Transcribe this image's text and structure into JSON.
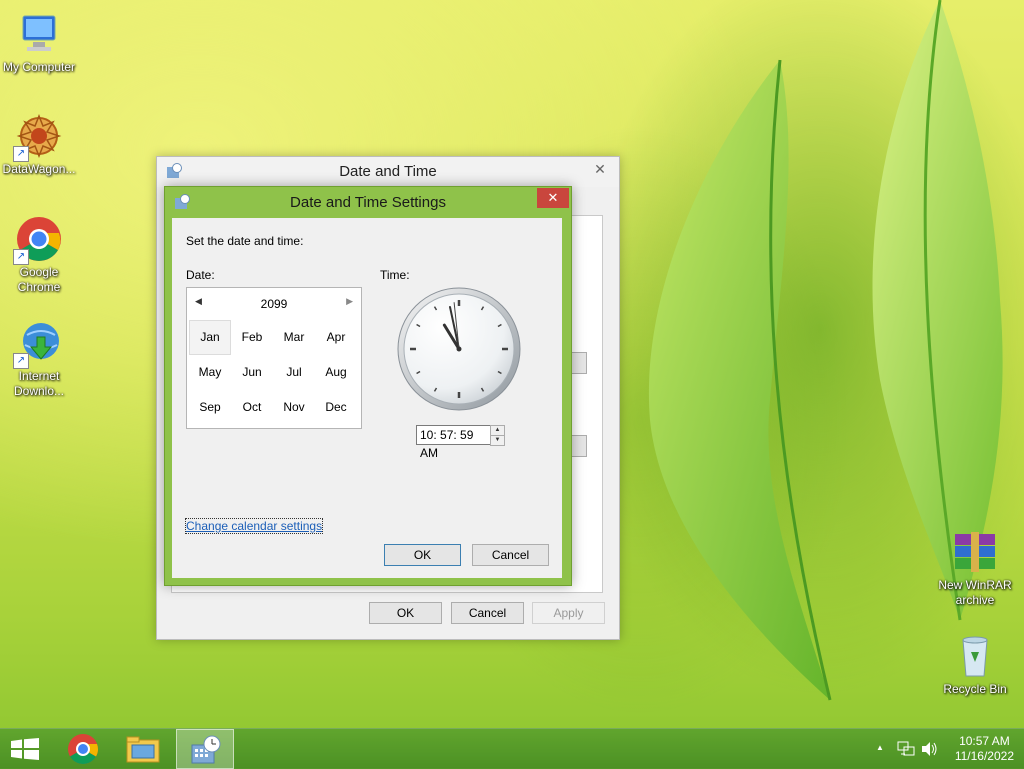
{
  "desktop": {
    "icons": [
      {
        "label": "My Computer"
      },
      {
        "label": "DataWagon..."
      },
      {
        "label": "Google Chrome"
      },
      {
        "label": "Internet Downlo..."
      },
      {
        "label": "New WinRAR archive"
      },
      {
        "label": "Recycle Bin"
      }
    ]
  },
  "outer_window": {
    "title": "Date and Time",
    "close_label": "✕",
    "ok_label": "OK",
    "cancel_label": "Cancel",
    "apply_label": "Apply"
  },
  "dialog": {
    "title": "Date and Time Settings",
    "close_label": "✕",
    "instruction": "Set the date and time:",
    "date_label": "Date:",
    "time_label": "Time:",
    "calendar": {
      "year": "2099",
      "prev_icon": "◀",
      "next_icon": "▶",
      "selected_month": "Jan",
      "months": [
        "Jan",
        "Feb",
        "Mar",
        "Apr",
        "May",
        "Jun",
        "Jul",
        "Aug",
        "Sep",
        "Oct",
        "Nov",
        "Dec"
      ]
    },
    "time_value": "10: 57: 59 AM",
    "clock": {
      "hour": 10,
      "minute": 57,
      "second": 59
    },
    "change_calendar_link": "Change calendar settings",
    "ok_label": "OK",
    "cancel_label": "Cancel"
  },
  "taskbar": {
    "time": "10:57 AM",
    "date": "11/16/2022",
    "tray_up_icon": "▲"
  },
  "colors": {
    "dialog_frame": "#8fc24a",
    "close_button": "#c9463d",
    "link": "#1c5fb8"
  }
}
